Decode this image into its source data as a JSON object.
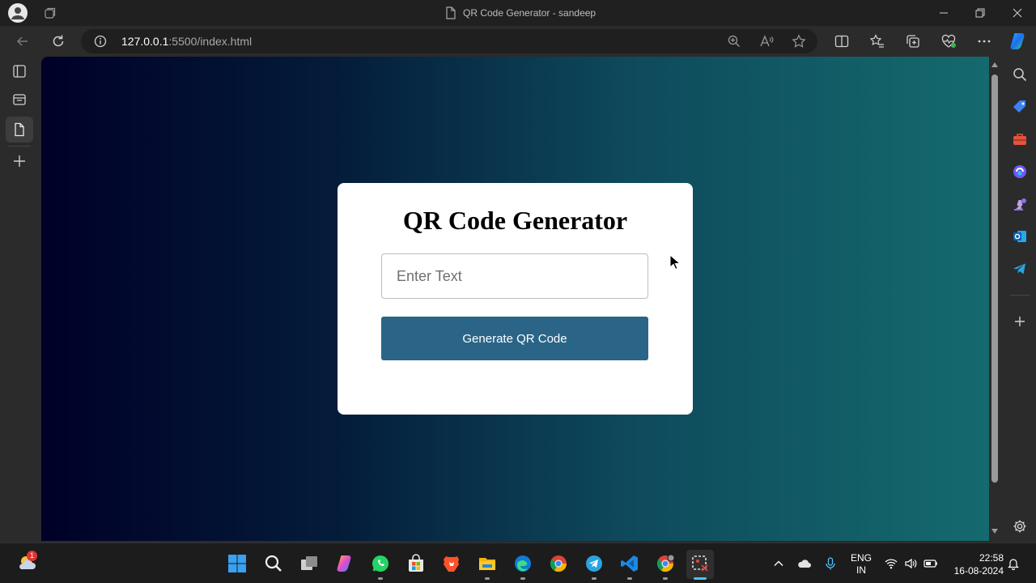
{
  "window": {
    "title": "QR Code Generator - sandeep"
  },
  "address_bar": {
    "host": "127.0.0.1",
    "path": ":5500/index.html"
  },
  "page": {
    "heading": "QR Code Generator",
    "input_placeholder": "Enter Text",
    "input_value": "",
    "button_label": "Generate QR Code",
    "background_gradient": [
      "#000028",
      "#041d3a",
      "#0e4a5c",
      "#146a6e"
    ],
    "button_color": "#2a6587"
  },
  "taskbar": {
    "weather_badge": "1",
    "language": "ENG",
    "region": "IN",
    "time": "22:58",
    "date": "16-08-2024"
  },
  "icons": {
    "titlebar": [
      "profile-avatar-icon",
      "workspaces-icon",
      "document-icon",
      "minimize-icon",
      "restore-icon",
      "close-icon"
    ],
    "toolbar": [
      "back-arrow-icon",
      "refresh-icon",
      "info-icon",
      "zoom-icon",
      "read-aloud-icon",
      "favorite-star-icon",
      "split-screen-icon",
      "favorites-icon",
      "collections-icon",
      "browser-essentials-icon",
      "more-icon",
      "copilot-icon"
    ],
    "left_sidebar": [
      "tab-actions-icon",
      "tab-icon",
      "page-tab-icon",
      "new-tab-plus-icon"
    ],
    "right_sidebar": [
      "search-icon",
      "shopping-tag-icon",
      "tools-icon",
      "edge-copilot-icon",
      "games-icon",
      "outlook-icon",
      "telegram-icon",
      "add-icon",
      "settings-gear-icon"
    ],
    "taskbar_apps": [
      "weather-icon",
      "windows-start-icon",
      "search-icon",
      "task-view-icon",
      "copilot-icon",
      "whatsapp-icon",
      "microsoft-store-icon",
      "brave-icon",
      "file-explorer-icon",
      "edge-icon",
      "chrome-icon",
      "telegram-icon",
      "vscode-icon",
      "chrome-profile-icon",
      "snipping-tool-icon"
    ],
    "tray": [
      "chevron-up-icon",
      "onedrive-cloud-icon",
      "microphone-icon",
      "wifi-icon",
      "volume-icon",
      "battery-icon",
      "notification-bell-icon"
    ]
  }
}
